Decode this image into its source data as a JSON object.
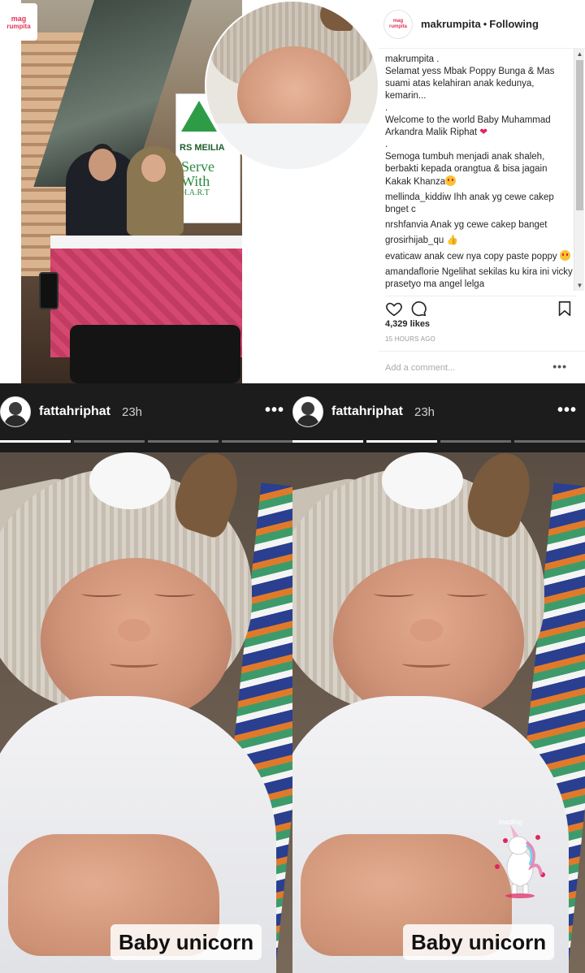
{
  "post": {
    "logo": {
      "line1": "mag",
      "line2": "rumpita"
    },
    "banner": {
      "brand": "RS MEILIA",
      "slogan_line1": "Serve",
      "slogan_line2": "With",
      "slogan_line3": "H.A.R.T"
    },
    "header": {
      "username": "makrumpita",
      "separator": "•",
      "follow_status": "Following"
    },
    "caption": {
      "username": "makrumpita .",
      "line1": "Selamat yess Mbak Poppy Bunga & Mas suami atas kelahiran anak kedunya, kemarin...",
      "dot1": ".",
      "line2": "Welcome to the world Baby Muhammad Arkandra Malik Riphat",
      "dot2": ".",
      "line3": "Semoga tumbuh menjadi anak shaleh, berbakti kepada orangtua & bisa jagain Kakak Khanza"
    },
    "comments": [
      {
        "user": "mellinda_kiddiw",
        "text": "Ihh anak yg cewe cakep bnget c"
      },
      {
        "user": "nrshfanvia",
        "text": "Anak yg cewe cakep banget"
      },
      {
        "user": "grosirhijab_qu",
        "text": ""
      },
      {
        "user": "evaticaw",
        "text": "anak cew nya copy paste poppy"
      },
      {
        "user": "amandaflorie",
        "text": "Ngelihat sekilas ku kira ini vicky prasetyo ma angel lelga"
      }
    ],
    "likes": "4,329 likes",
    "time": "15 HOURS AGO",
    "add_comment_placeholder": "Add a comment...",
    "more": "•••"
  },
  "stories": [
    {
      "username": "fattahriphat",
      "time": "23h",
      "more": "•••",
      "caption": "Baby unicorn",
      "segments": [
        1,
        0,
        0,
        0
      ]
    },
    {
      "username": "fattahriphat",
      "time": "23h",
      "more": "•••",
      "caption": "Baby unicorn",
      "segments": [
        1,
        1,
        0,
        0
      ],
      "sticker_label": "loading"
    }
  ],
  "colors": {
    "accent_pink": "#e2335a",
    "heart_red": "#e0245e",
    "story_bg": "#1c1c1c"
  }
}
